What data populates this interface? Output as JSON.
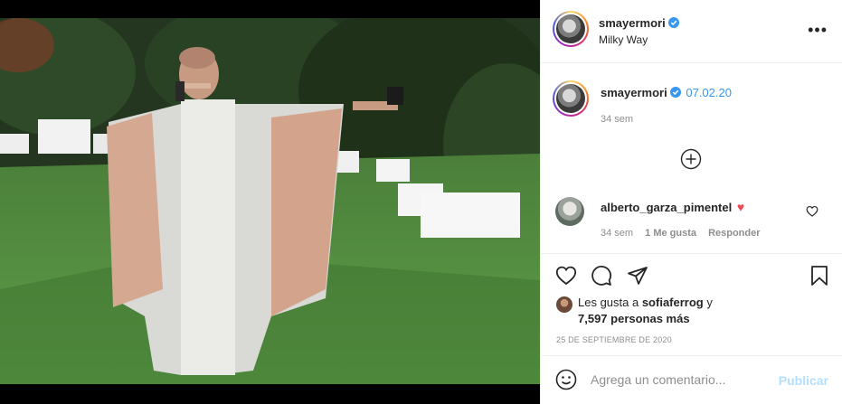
{
  "post": {
    "author": {
      "username": "smayermori",
      "verified": true,
      "location": "Milky Way"
    },
    "more_icon": "more-horizontal-icon",
    "caption": {
      "username": "smayermori",
      "text": "07.02.20",
      "age": "34 sem"
    },
    "load_more_icon": "plus-circle-icon",
    "comments": [
      {
        "username": "alberto_garza_pimentel",
        "text": "♥",
        "age": "34 sem",
        "likes": "1 Me gusta",
        "reply": "Responder"
      }
    ],
    "actions": {
      "like_icon": "heart-icon",
      "comment_icon": "comment-icon",
      "share_icon": "share-icon",
      "save_icon": "bookmark-icon"
    },
    "likes": {
      "prefix": "Les gusta a ",
      "user": "sofiaferrog",
      "conj": " y",
      "others": "7,597 personas más"
    },
    "date": "25 DE SEPTIEMBRE DE 2020",
    "composer": {
      "emoji_icon": "emoji-icon",
      "placeholder": "Agrega un comentario...",
      "publish": "Publicar"
    }
  },
  "colors": {
    "verified": "#3897f0",
    "heart": "#ed4956",
    "publish_disabled": "#b2dffc",
    "muted": "#8e8e8e"
  }
}
